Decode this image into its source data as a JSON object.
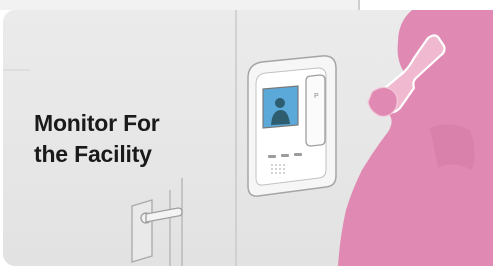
{
  "title": {
    "line1": "Monitor For",
    "line2": "the Facility"
  },
  "colors": {
    "background": "#e6e6e6",
    "wall_divider": "#c9c9c9",
    "person": "#e089b2",
    "handset": "#f0b9cf",
    "screen": "#5aa9d8",
    "title_text": "#1a1a1a"
  },
  "icons": [
    "door-handle-icon",
    "intercom-monitor-icon",
    "person-on-phone-icon"
  ]
}
